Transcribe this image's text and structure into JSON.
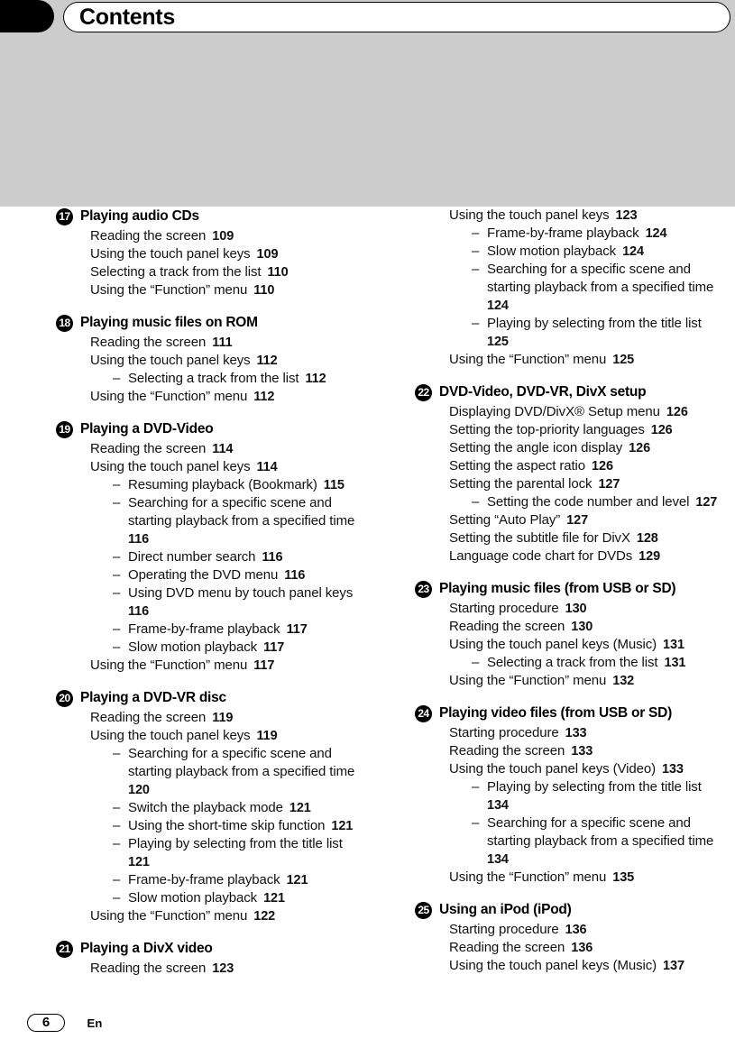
{
  "header": {
    "title": "Contents",
    "tab_icon": "black-rounded-tab"
  },
  "footer": {
    "page_number": "6",
    "language_code": "En"
  },
  "columns": [
    {
      "id": "left",
      "sections": [
        {
          "number": "17",
          "title": "Playing audio CDs",
          "entries": [
            {
              "level": 1,
              "label": "Reading the screen",
              "page": "109"
            },
            {
              "level": 1,
              "label": "Using the touch panel keys",
              "page": "109"
            },
            {
              "level": 1,
              "label": "Selecting a track from the list",
              "page": "110"
            },
            {
              "level": 1,
              "label": "Using the “Function” menu",
              "page": "110"
            }
          ]
        },
        {
          "number": "18",
          "title": "Playing music files on ROM",
          "entries": [
            {
              "level": 1,
              "label": "Reading the screen",
              "page": "111"
            },
            {
              "level": 1,
              "label": "Using the touch panel keys",
              "page": "112"
            },
            {
              "level": 2,
              "label": "Selecting a track from the list",
              "page": "112"
            },
            {
              "level": 1,
              "label": "Using the “Function” menu",
              "page": "112"
            }
          ]
        },
        {
          "number": "19",
          "title": "Playing a DVD-Video",
          "entries": [
            {
              "level": 1,
              "label": "Reading the screen",
              "page": "114"
            },
            {
              "level": 1,
              "label": "Using the touch panel keys",
              "page": "114"
            },
            {
              "level": 2,
              "label": "Resuming playback (Bookmark)",
              "page": "115"
            },
            {
              "level": 2,
              "label": "Searching for a specific scene and starting playback from a specified time",
              "page": "116"
            },
            {
              "level": 2,
              "label": "Direct number search",
              "page": "116"
            },
            {
              "level": 2,
              "label": "Operating the DVD menu",
              "page": "116"
            },
            {
              "level": 2,
              "label": "Using DVD menu by touch panel keys",
              "page": "116"
            },
            {
              "level": 2,
              "label": "Frame-by-frame playback",
              "page": "117"
            },
            {
              "level": 2,
              "label": "Slow motion playback",
              "page": "117"
            },
            {
              "level": 1,
              "label": "Using the “Function” menu",
              "page": "117"
            }
          ]
        },
        {
          "number": "20",
          "title": "Playing a DVD-VR disc",
          "entries": [
            {
              "level": 1,
              "label": "Reading the screen",
              "page": "119"
            },
            {
              "level": 1,
              "label": "Using the touch panel keys",
              "page": "119"
            },
            {
              "level": 2,
              "label": "Searching for a specific scene and starting playback from a specified time",
              "page": "120"
            },
            {
              "level": 2,
              "label": "Switch the playback mode",
              "page": "121"
            },
            {
              "level": 2,
              "label": "Using the short-time skip function",
              "page": "121"
            },
            {
              "level": 2,
              "label": "Playing by selecting from the title list",
              "page": "121"
            },
            {
              "level": 2,
              "label": "Frame-by-frame playback",
              "page": "121"
            },
            {
              "level": 2,
              "label": "Slow motion playback",
              "page": "121"
            },
            {
              "level": 1,
              "label": "Using the “Function” menu",
              "page": "122"
            }
          ]
        },
        {
          "number": "21",
          "title": "Playing a DivX video",
          "entries": [
            {
              "level": 1,
              "label": "Reading the screen",
              "page": "123"
            }
          ]
        }
      ]
    },
    {
      "id": "right",
      "sections": [
        {
          "number": "",
          "title": "",
          "entries": [
            {
              "level": 1,
              "label": "Using the touch panel keys",
              "page": "123"
            },
            {
              "level": 2,
              "label": "Frame-by-frame playback",
              "page": "124"
            },
            {
              "level": 2,
              "label": "Slow motion playback",
              "page": "124"
            },
            {
              "level": 2,
              "label": "Searching for a specific scene and starting playback from a specified time",
              "page": "124"
            },
            {
              "level": 2,
              "label": "Playing by selecting from the title list",
              "page": "125"
            },
            {
              "level": 1,
              "label": "Using the “Function” menu",
              "page": "125"
            }
          ]
        },
        {
          "number": "22",
          "title": "DVD-Video, DVD-VR, DivX setup",
          "entries": [
            {
              "level": 1,
              "label": "Displaying DVD/DivX® Setup menu",
              "page": "126"
            },
            {
              "level": 1,
              "label": "Setting the top-priority languages",
              "page": "126"
            },
            {
              "level": 1,
              "label": "Setting the angle icon display",
              "page": "126"
            },
            {
              "level": 1,
              "label": "Setting the aspect ratio",
              "page": "126"
            },
            {
              "level": 1,
              "label": "Setting the parental lock",
              "page": "127"
            },
            {
              "level": 2,
              "label": "Setting the code number and level",
              "page": "127"
            },
            {
              "level": 1,
              "label": "Setting “Auto Play”",
              "page": "127"
            },
            {
              "level": 1,
              "label": "Setting the subtitle file for DivX",
              "page": "128"
            },
            {
              "level": 1,
              "label": "Language code chart for DVDs",
              "page": "129"
            }
          ]
        },
        {
          "number": "23",
          "title": "Playing music files (from USB or SD)",
          "entries": [
            {
              "level": 1,
              "label": "Starting procedure",
              "page": "130"
            },
            {
              "level": 1,
              "label": "Reading the screen",
              "page": "130"
            },
            {
              "level": 1,
              "label": "Using the touch panel keys (Music)",
              "page": "131"
            },
            {
              "level": 2,
              "label": "Selecting a track from the list",
              "page": "131"
            },
            {
              "level": 1,
              "label": "Using the “Function” menu",
              "page": "132"
            }
          ]
        },
        {
          "number": "24",
          "title": "Playing video files (from USB or SD)",
          "entries": [
            {
              "level": 1,
              "label": "Starting procedure",
              "page": "133"
            },
            {
              "level": 1,
              "label": "Reading the screen",
              "page": "133"
            },
            {
              "level": 1,
              "label": "Using the touch panel keys (Video)",
              "page": "133"
            },
            {
              "level": 2,
              "label": "Playing by selecting from the title list",
              "page": "134"
            },
            {
              "level": 2,
              "label": "Searching for a specific scene and starting playback from a specified time",
              "page": "134"
            },
            {
              "level": 1,
              "label": "Using the “Function” menu",
              "page": "135"
            }
          ]
        },
        {
          "number": "25",
          "title": "Using an iPod (iPod)",
          "entries": [
            {
              "level": 1,
              "label": "Starting procedure",
              "page": "136"
            },
            {
              "level": 1,
              "label": "Reading the screen",
              "page": "136"
            },
            {
              "level": 1,
              "label": "Using the touch panel keys (Music)",
              "page": "137"
            }
          ]
        }
      ]
    }
  ]
}
